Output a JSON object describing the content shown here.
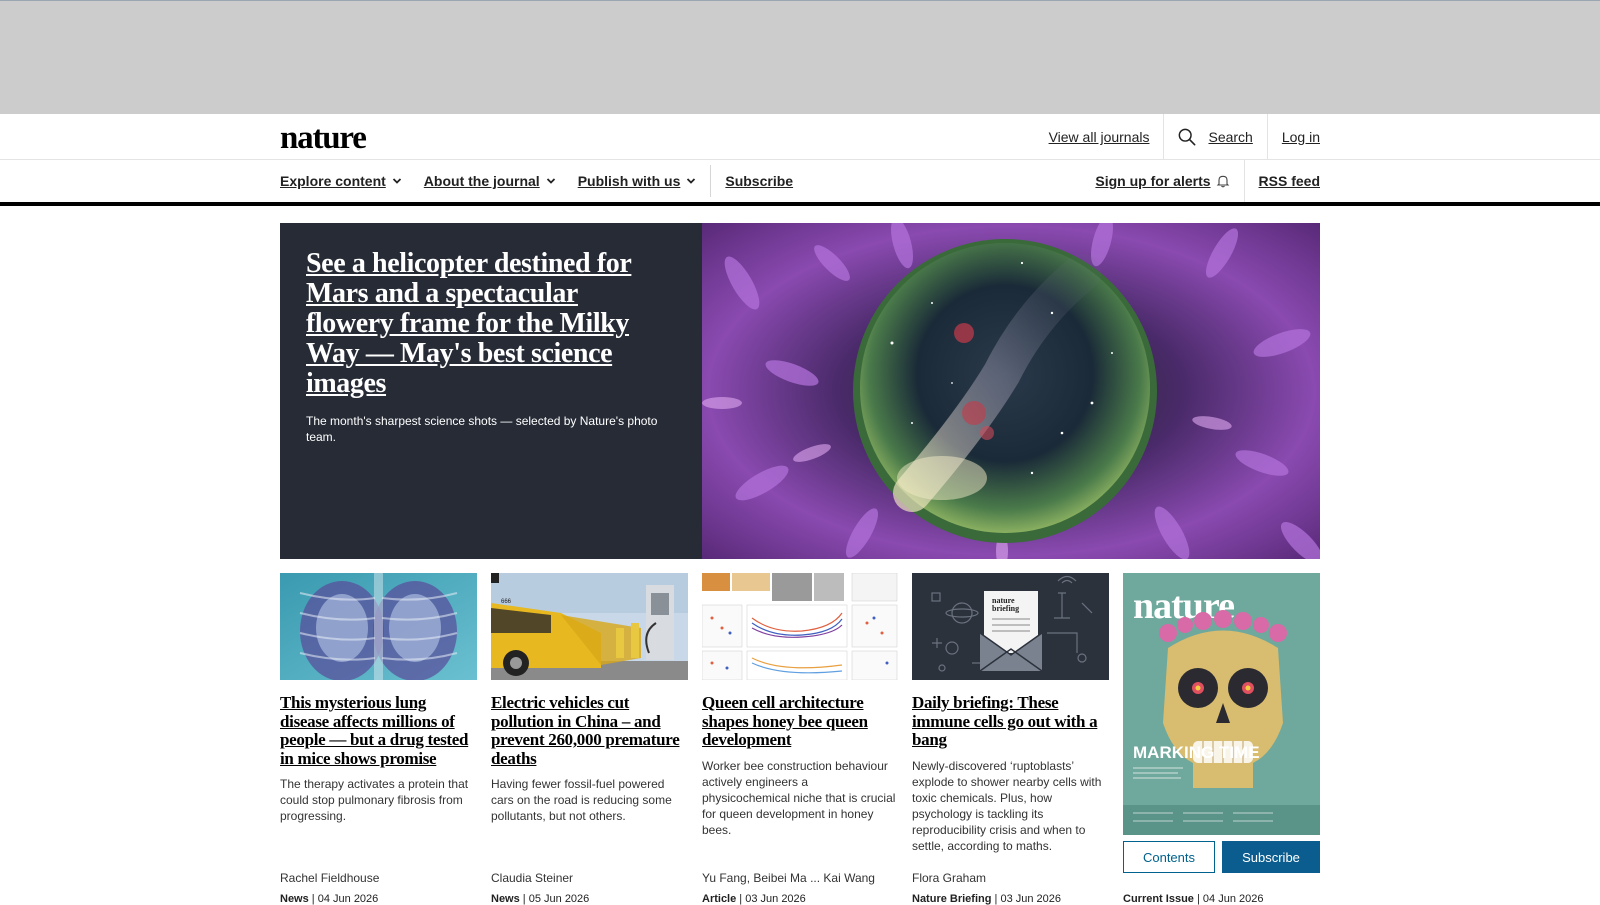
{
  "header": {
    "logo": "nature",
    "view_all_journals": "View all journals",
    "search_label": "Search",
    "login_label": "Log in"
  },
  "nav": {
    "explore_content": "Explore content",
    "about_journal": "About the journal",
    "publish_with_us": "Publish with us",
    "subscribe": "Subscribe",
    "sign_up_alerts": "Sign up for alerts",
    "rss_feed": "RSS feed"
  },
  "hero": {
    "title": "See a helicopter destined for Mars and a spectacular flowery frame for the Milky Way — May's best science images",
    "standfirst": "The month's sharpest science shots — selected by Nature's photo team."
  },
  "cards": [
    {
      "title": "This mysterious lung disease affects millions of people — but a drug tested in mice shows promise",
      "description": "The therapy activates a protein that could stop pulmonary fibrosis from progressing.",
      "author": "Rachel Fieldhouse",
      "type": "News",
      "date": "04 Jun 2026"
    },
    {
      "title": "Electric vehicles cut pollution in China – and prevent 260,000 premature deaths",
      "description": "Having fewer fossil-fuel powered cars on the road is reducing some pollutants, but not others.",
      "author": "Claudia Steiner",
      "type": "News",
      "date": "05 Jun 2026"
    },
    {
      "title": "Queen cell architecture shapes honey bee queen development",
      "description": "Worker bee construction behaviour actively engineers a physicochemical niche that is crucial for queen development in honey bees.",
      "author": "Yu Fang, Beibei Ma ... Kai Wang",
      "type": "Article",
      "date": "03 Jun 2026"
    },
    {
      "title": "Daily briefing: These immune cells go out with a bang",
      "description": "Newly-discovered ‘ruptoblasts’ explode to shower nearby cells with toxic chemicals. Plus, how psychology is tackling its reproducibility crisis and when to settle, according to maths.",
      "author": "Flora Graham",
      "type": "Nature Briefing",
      "date": "03 Jun 2026"
    }
  ],
  "current_issue": {
    "cover_masthead": "nature",
    "cover_headline": "MARKING TIME",
    "contents_label": "Contents",
    "subscribe_label": "Subscribe",
    "type": "Current Issue",
    "date": "04 Jun 2026"
  },
  "colors": {
    "hero_bg": "#262b36",
    "accent_blue": "#0a5d8e",
    "ad_banner": "#cccccc"
  }
}
